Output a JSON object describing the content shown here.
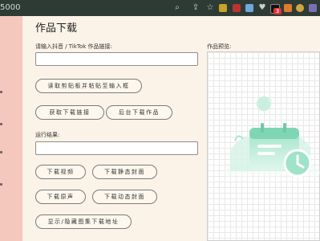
{
  "browser": {
    "url_fragment": "5000",
    "notification_count": "3"
  },
  "page": {
    "title": "作品下载",
    "link_label": "请输入抖音 / TikTok 作品链接:",
    "link_value": "",
    "paste_input_button": "读取剪贴板并粘贴至输入框",
    "get_link_button": "获取下载链接",
    "background_download_button": "后台下载作品",
    "result_label": "运行结果:",
    "result_value": "",
    "download_video_button": "下载视频",
    "download_static_cover_button": "下载静态封面",
    "download_audio_button": "下载原声",
    "download_dynamic_cover_button": "下载动态封面",
    "toggle_gallery_button": "显示/隐藏图集下载地址",
    "preview_label": "作品预览:"
  },
  "colors": {
    "panel_bg": "#fbf3e7",
    "left_strip": "#f5c8bd",
    "topbar": "#2e3b35",
    "illustration_accent": "#8fdcc0"
  }
}
